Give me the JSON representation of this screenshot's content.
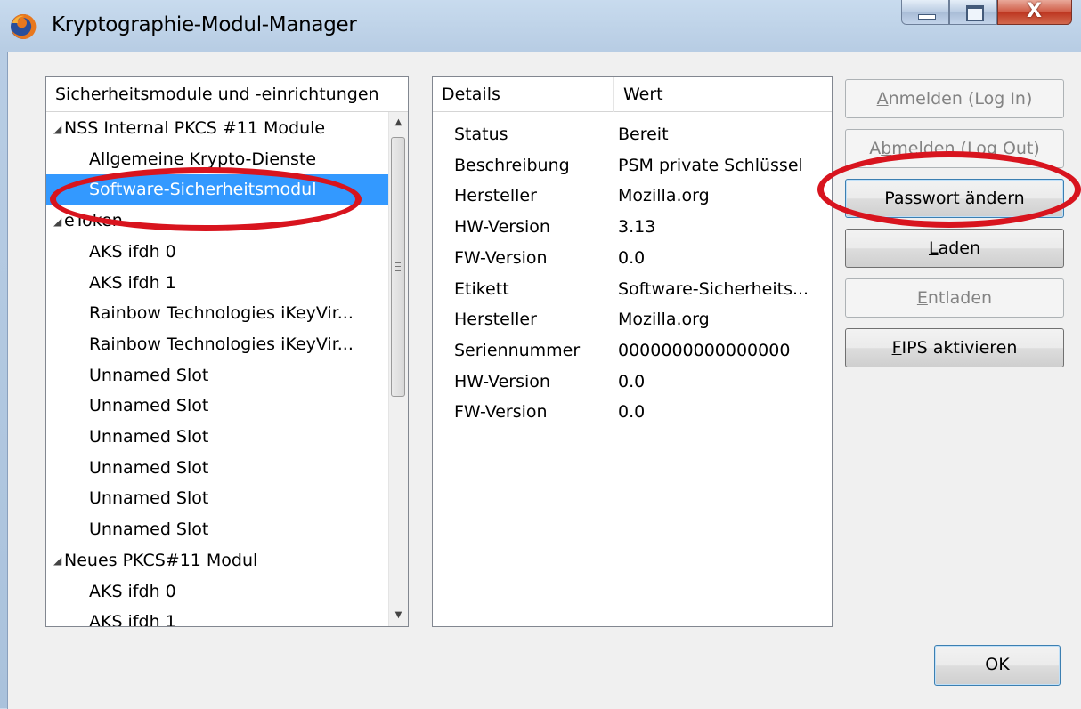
{
  "window": {
    "title": "Kryptographie-Modul-Manager",
    "icon": "firefox-icon",
    "caption_icons": [
      "minimize-icon",
      "maximize-icon",
      "close-icon"
    ],
    "close_glyph": "X"
  },
  "tree": {
    "header": "Sicherheitsmodule und -einrichtungen",
    "rows": [
      {
        "label": "NSS Internal PKCS #11 Module",
        "level": 0,
        "expanded": true
      },
      {
        "label": "Allgemeine Krypto-Dienste",
        "level": 1
      },
      {
        "label": "Software-Sicherheitsmodul",
        "level": 1,
        "selected": true
      },
      {
        "label": "eToken",
        "level": 0,
        "expanded": true
      },
      {
        "label": "AKS ifdh 0",
        "level": 1
      },
      {
        "label": "AKS ifdh 1",
        "level": 1
      },
      {
        "label": "Rainbow Technologies iKeyVir...",
        "level": 1
      },
      {
        "label": "Rainbow Technologies iKeyVir...",
        "level": 1
      },
      {
        "label": "Unnamed Slot",
        "level": 1
      },
      {
        "label": "Unnamed Slot",
        "level": 1
      },
      {
        "label": "Unnamed Slot",
        "level": 1
      },
      {
        "label": "Unnamed Slot",
        "level": 1
      },
      {
        "label": "Unnamed Slot",
        "level": 1
      },
      {
        "label": "Unnamed Slot",
        "level": 1
      },
      {
        "label": "Neues PKCS#11 Modul",
        "level": 0,
        "expanded": true
      },
      {
        "label": "AKS ifdh 0",
        "level": 1
      },
      {
        "label": "AKS ifdh 1",
        "level": 1
      }
    ]
  },
  "details": {
    "col_details": "Details",
    "col_value": "Wert",
    "rows": [
      {
        "key": "Status",
        "value": "Bereit"
      },
      {
        "key": "Beschreibung",
        "value": "PSM private Schlüssel"
      },
      {
        "key": "Hersteller",
        "value": "Mozilla.org"
      },
      {
        "key": "HW-Version",
        "value": "3.13"
      },
      {
        "key": "FW-Version",
        "value": "0.0"
      },
      {
        "key": "Etikett",
        "value": "Software-Sicherheits..."
      },
      {
        "key": "Hersteller",
        "value": "Mozilla.org"
      },
      {
        "key": "Seriennummer",
        "value": "0000000000000000"
      },
      {
        "key": "HW-Version",
        "value": "0.0"
      },
      {
        "key": "FW-Version",
        "value": "0.0"
      }
    ]
  },
  "buttons": {
    "login": {
      "pre": "",
      "ul": "A",
      "post": "nmelden (Log In)",
      "enabled": false
    },
    "logout": {
      "pre": "A",
      "ul": "b",
      "post": "melden (Log Out)",
      "enabled": false
    },
    "change_password": {
      "pre": "",
      "ul": "P",
      "post": "asswort ändern",
      "enabled": true
    },
    "load": {
      "pre": "",
      "ul": "L",
      "post": "aden",
      "enabled": true
    },
    "unload": {
      "pre": "",
      "ul": "E",
      "post": "ntladen",
      "enabled": false
    },
    "fips": {
      "pre": "",
      "ul": "F",
      "post": "IPS aktivieren",
      "enabled": true
    },
    "ok": "OK"
  },
  "colors": {
    "selection": "#3399ff",
    "annotation_red": "#d8141e"
  }
}
